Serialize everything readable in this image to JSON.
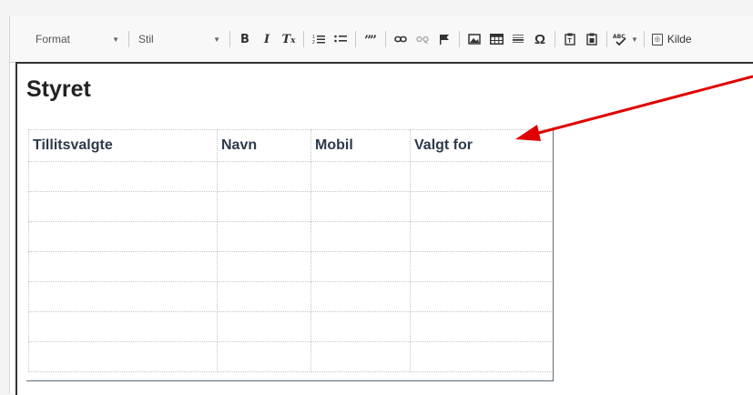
{
  "toolbar": {
    "format_label": "Format",
    "style_label": "Stil",
    "source_label": "Kilde",
    "buttons": {
      "bold": "B",
      "italic": "I",
      "remove_format": "Tx",
      "numbered_list": "1≡",
      "bulleted_list": "⁝≡",
      "blockquote": "❞",
      "link": "⊖",
      "unlink": "⊘",
      "anchor": "⚑",
      "image": "▣",
      "table": "▦",
      "horizontal_line": "≡",
      "special_char": "Ω",
      "paste_text": "📋",
      "paste_word": "📋",
      "spellcheck": "ABC"
    }
  },
  "document": {
    "heading": "Styret",
    "table": {
      "headers": [
        "Tillitsvalgte",
        "Navn",
        "Mobil",
        "Valgt for"
      ],
      "rows": [
        [
          "",
          "",
          "",
          ""
        ],
        [
          "",
          "",
          "",
          ""
        ],
        [
          "",
          "",
          "",
          ""
        ],
        [
          "",
          "",
          "",
          ""
        ],
        [
          "",
          "",
          "",
          ""
        ],
        [
          "",
          "",
          "",
          ""
        ],
        [
          "",
          "",
          "",
          ""
        ]
      ]
    }
  },
  "annotation": {
    "arrow_color": "#e00000"
  }
}
